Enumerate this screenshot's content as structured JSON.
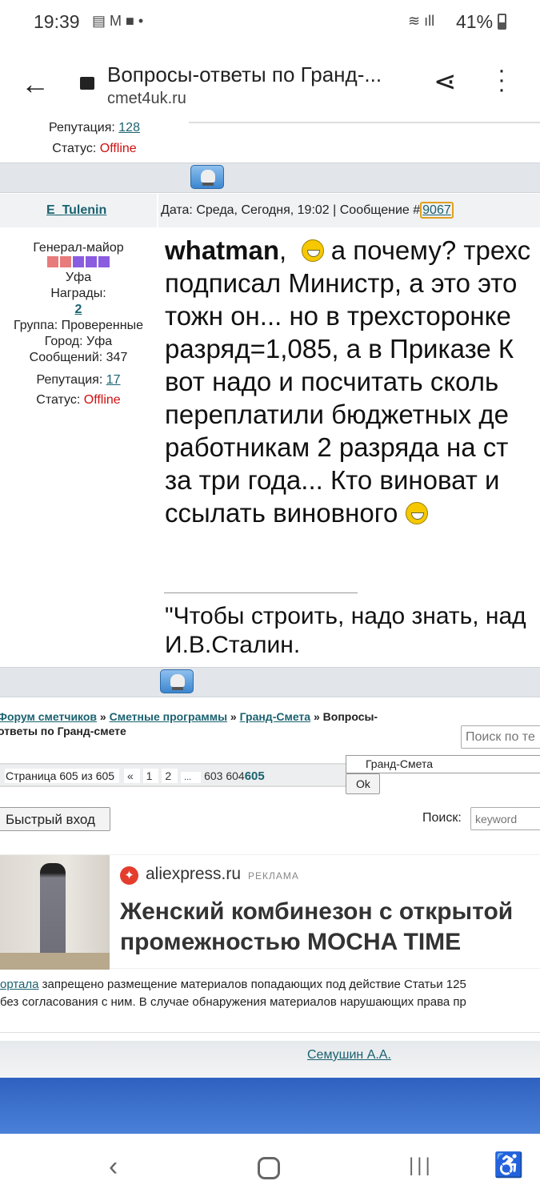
{
  "status_bar": {
    "time": "19:39",
    "battery": "41%",
    "dot": "•"
  },
  "browser": {
    "title": "Вопросы-ответы по Гранд-...",
    "domain": "cmet4uk.ru"
  },
  "prev_user": {
    "rep_label": "Репутация: ",
    "rep_value": "128",
    "status_label": "Статус: ",
    "status_value": "Offline"
  },
  "post": {
    "author": "E_Tulenin",
    "date_text": "Дата: Среда, Сегодня, 19:02 | Сообщение #",
    "msg_num": "9067",
    "rank": "Генерал-майор",
    "location": "Уфа",
    "awards_label": "Награды:",
    "awards_value": "2",
    "group": "Группа: Проверенные",
    "city": "Город: Уфа",
    "messages": "Сообщений: 347",
    "rep_label": "Репутация: ",
    "rep_value": "17",
    "status_label": "Статус: ",
    "status_value": "Offline",
    "addressee": "whatman",
    "lines": [
      "а почему? трехс",
      "подписал Министр, а это это",
      "тожн он... но в трехсторонке",
      "разряд=1,085, а в Приказе К",
      "вот надо и посчитать сколь",
      "переплатили бюджетных де",
      "работникам 2 разряда на ст",
      "за три года... Кто виноват и",
      "ссылать виновного"
    ],
    "signature": [
      "\"Чтобы строить, надо знать, над",
      "И.В.Сталин."
    ]
  },
  "breadcrumb": {
    "items": [
      "Форум сметчиков",
      "Сметные программы",
      "Гранд-Смета"
    ],
    "sep": " » ",
    "current_1": "Вопросы-",
    "current_2": "ответы по Гранд-смете"
  },
  "topic_search_placeholder": "Поиск по те",
  "pagination": {
    "label": "Страница 605 из 605",
    "prev": "«",
    "pages": [
      "1",
      "2",
      "...",
      "603",
      "604"
    ],
    "current": "605"
  },
  "forum_select": "Гранд-Смета",
  "ok_label": "Ok",
  "quick_login": "Быстрый вход",
  "search": {
    "label": "Поиск:",
    "placeholder": "keyword"
  },
  "ad": {
    "source": "aliexpress.ru",
    "tag": "РЕКЛАМА",
    "title_1": "Женский комбинезон с открытой",
    "title_2": "промежностью MOCHA TIME"
  },
  "disclaimer": {
    "link": "ортала",
    "line1": " запрещено размещение материалов попадающих под действие Статьи 125",
    "line2": " без согласования с ним. В случае обнаружения материалов нарушающих права пр"
  },
  "footer_link": "Семушин А.А."
}
